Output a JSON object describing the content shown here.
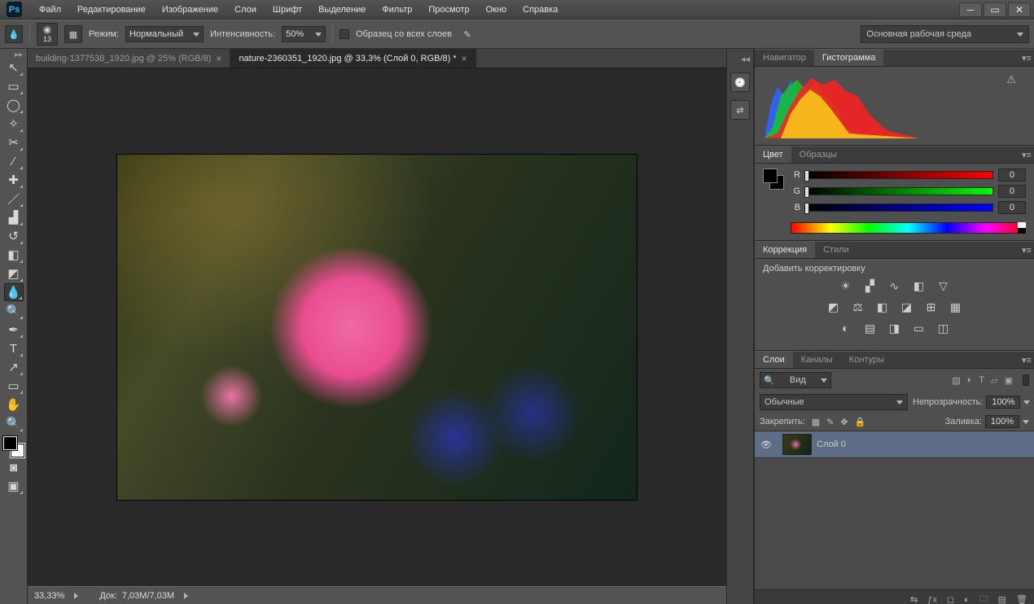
{
  "menu": [
    "Файл",
    "Редактирование",
    "Изображение",
    "Слои",
    "Шрифт",
    "Выделение",
    "Фильтр",
    "Просмотр",
    "Окно",
    "Справка"
  ],
  "options": {
    "brushSize": "13",
    "modeLabel": "Режим:",
    "modeValue": "Нормальный",
    "intensityLabel": "Интенсивность:",
    "intensityValue": "50%",
    "sampleAllLabel": "Образец со всех слоев",
    "workspace": "Основная рабочая среда"
  },
  "tabs": [
    {
      "title": "building-1377538_1920.jpg @ 25% (RGB/8)",
      "active": false
    },
    {
      "title": "nature-2360351_1920.jpg @ 33,3% (Слой 0, RGB/8) *",
      "active": true
    }
  ],
  "status": {
    "zoom": "33,33%",
    "docLabel": "Док:",
    "docValue": "7,03M/7,03M"
  },
  "panels": {
    "nav": {
      "tab1": "Навигатор",
      "tab2": "Гистограмма"
    },
    "color": {
      "tab1": "Цвет",
      "tab2": "Образцы",
      "r": "R",
      "g": "G",
      "b": "B",
      "rVal": "0",
      "gVal": "0",
      "bVal": "0"
    },
    "adjust": {
      "tab1": "Коррекция",
      "tab2": "Стили",
      "title": "Добавить корректировку"
    },
    "layers": {
      "tab1": "Слои",
      "tab2": "Каналы",
      "tab3": "Контуры",
      "searchLabel": "Вид",
      "blend": "Обычные",
      "opacityLabel": "Непрозрачность:",
      "opacityVal": "100%",
      "lockLabel": "Закрепить:",
      "fillLabel": "Заливка:",
      "fillVal": "100%",
      "layer0": "Слой 0"
    }
  }
}
